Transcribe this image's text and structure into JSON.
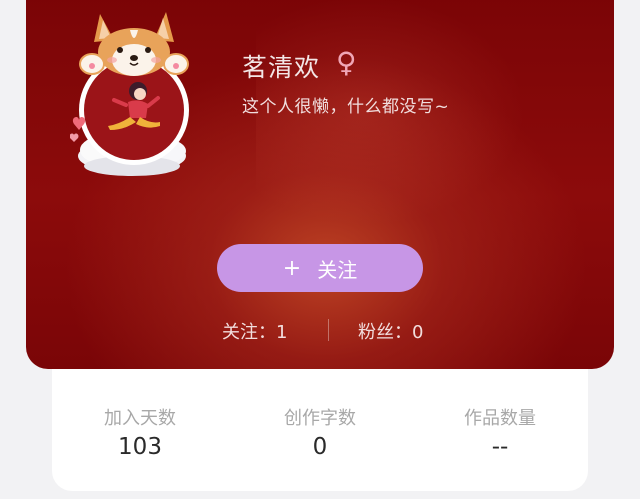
{
  "profile": {
    "username": "茗清欢",
    "gender_symbol": "♀",
    "bio": "这个人很懒，什么都没写~",
    "follow_button": {
      "icon": "+",
      "label": "关注"
    },
    "following": {
      "label": "关注：",
      "count": "1"
    },
    "fans": {
      "label": "粉丝：",
      "count": "0"
    }
  },
  "stats": [
    {
      "label": "加入天数",
      "value": "103"
    },
    {
      "label": "创作字数",
      "value": "0"
    },
    {
      "label": "作品数量",
      "value": "--"
    }
  ],
  "colors": {
    "header_background": "#7d0608",
    "follow_button": "#c796e6",
    "gender_icon": "#f0a6b6"
  },
  "icons": {
    "avatar": "corgi-frame-avatar-icon",
    "gender": "female-icon"
  }
}
